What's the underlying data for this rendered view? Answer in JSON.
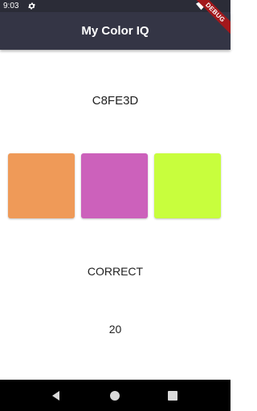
{
  "status_bar": {
    "time": "9:03",
    "icons": [
      "gear-icon",
      "wifi-icon"
    ]
  },
  "app_bar": {
    "title": "My Color IQ",
    "debug_banner": "DEBUG"
  },
  "game": {
    "hex_code": "C8FE3D",
    "swatches": [
      {
        "color": "#ef9a58"
      },
      {
        "color": "#cc61bb"
      },
      {
        "color": "#c8fe3d"
      }
    ],
    "result": "CORRECT",
    "score": "20"
  },
  "nav_bar": {
    "buttons": [
      "back-icon",
      "home-icon",
      "recents-icon"
    ]
  },
  "colors": {
    "status_bar": "#2b2c37",
    "app_bar": "#343545",
    "debug_ribbon": "#a3181c"
  }
}
